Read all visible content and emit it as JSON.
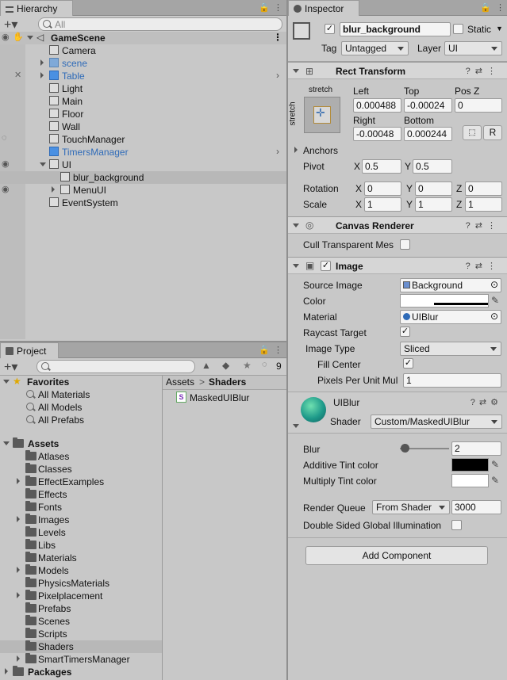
{
  "hierarchy": {
    "tab_label": "Hierarchy",
    "search_placeholder": "All",
    "scene_name": "GameScene",
    "items": [
      {
        "label": "Camera",
        "color": "#111111"
      },
      {
        "label": "scene",
        "color": "#2f6bb8"
      },
      {
        "label": "Table",
        "color": "#2f6bb8"
      },
      {
        "label": "Light",
        "color": "#111111"
      },
      {
        "label": "Main",
        "color": "#111111"
      },
      {
        "label": "Floor",
        "color": "#111111"
      },
      {
        "label": "Wall",
        "color": "#111111"
      },
      {
        "label": "TouchManager",
        "color": "#111111"
      },
      {
        "label": "TimersManager",
        "color": "#2f6bb8"
      },
      {
        "label": "UI",
        "color": "#111111"
      },
      {
        "label": "blur_background",
        "color": "#111111"
      },
      {
        "label": "MenuUI",
        "color": "#111111"
      },
      {
        "label": "EventSystem",
        "color": "#111111"
      }
    ]
  },
  "project": {
    "tab_label": "Project",
    "hidden_count": "9",
    "favorites_label": "Favorites",
    "favorites": [
      "All Materials",
      "All Models",
      "All Prefabs"
    ],
    "assets_label": "Assets",
    "folders": [
      "Atlases",
      "Classes",
      "EffectExamples",
      "Effects",
      "Fonts",
      "Images",
      "Levels",
      "Libs",
      "Materials",
      "Models",
      "PhysicsMaterials",
      "Pixelplacement",
      "Prefabs",
      "Scenes",
      "Scripts",
      "Shaders",
      "SmartTimersManager"
    ],
    "packages_label": "Packages",
    "breadcrumb_root": "Assets",
    "breadcrumb_sep": ">",
    "breadcrumb_current": "Shaders",
    "files": [
      "MaskedUIBlur"
    ]
  },
  "inspector": {
    "tab_label": "Inspector",
    "object_name": "blur_background",
    "static_label": "Static",
    "tag_label": "Tag",
    "tag_value": "Untagged",
    "layer_label": "Layer",
    "layer_value": "UI",
    "rect_transform": {
      "title": "Rect Transform",
      "anchor_top": "stretch",
      "anchor_side": "stretch",
      "left_label": "Left",
      "left": "0.000488",
      "top_label": "Top",
      "top": "-0.00024",
      "posz_label": "Pos Z",
      "posz": "0",
      "right_label": "Right",
      "right": "-0.00048",
      "bottom_label": "Bottom",
      "bottom": "0.000244",
      "r_button": "R",
      "anchors_label": "Anchors",
      "pivot_label": "Pivot",
      "pivot_x": "0.5",
      "pivot_y": "0.5",
      "rotation_label": "Rotation",
      "rot_x": "0",
      "rot_y": "0",
      "rot_z": "0",
      "scale_label": "Scale",
      "scale_x": "1",
      "scale_y": "1",
      "scale_z": "1",
      "x": "X",
      "y": "Y",
      "z": "Z"
    },
    "canvas_renderer": {
      "title": "Canvas Renderer",
      "cull_label": "Cull Transparent Mes"
    },
    "image": {
      "title": "Image",
      "source_label": "Source Image",
      "source_value": "Background",
      "color_label": "Color",
      "material_label": "Material",
      "material_value": "UIBlur",
      "raycast_label": "Raycast Target",
      "type_label": "Image Type",
      "type_value": "Sliced",
      "fill_label": "Fill Center",
      "ppu_label": "Pixels Per Unit Mul",
      "ppu_value": "1"
    },
    "material": {
      "title": "UIBlur",
      "shader_label": "Shader",
      "shader_value": "Custom/MaskedUIBlur",
      "blur_label": "Blur",
      "blur_value": "2",
      "blur_fraction": 0.1,
      "additive_label": "Additive Tint color",
      "additive_color": "#000000",
      "multiply_label": "Multiply Tint color",
      "multiply_color": "#ffffff",
      "queue_label": "Render Queue",
      "queue_mode": "From Shader",
      "queue_value": "3000",
      "dsgi_label": "Double Sided Global Illumination"
    },
    "add_component": "Add Component"
  }
}
